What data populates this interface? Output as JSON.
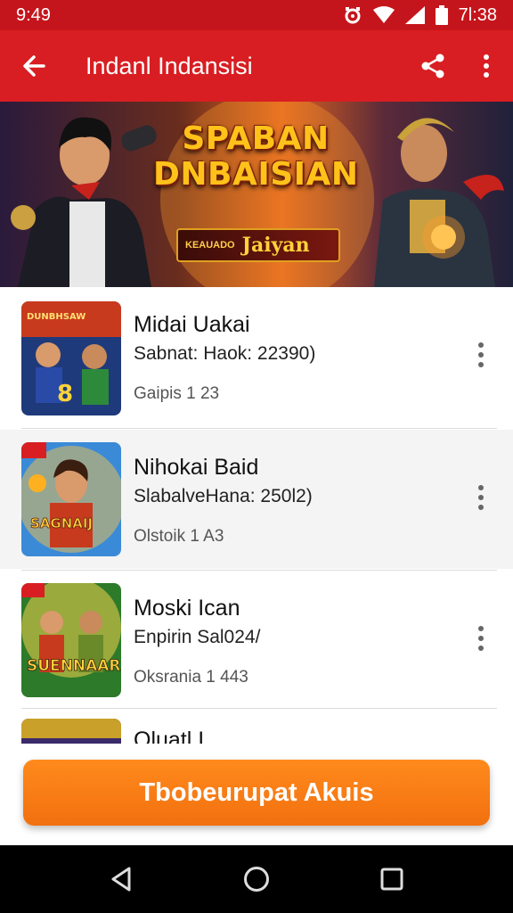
{
  "status_bar": {
    "time": "9:49",
    "clock": "7l:38",
    "icons": [
      "alarm-icon",
      "wifi-icon",
      "signal-icon",
      "battery-icon"
    ]
  },
  "app_bar": {
    "title": "Indanl Indansisi",
    "icons": [
      "back-arrow-icon",
      "share-icon",
      "more-vert-icon"
    ]
  },
  "banner": {
    "title_line1": "SPABAN",
    "title_line2": "DNBAISIAN",
    "tag_small": "KEAUADO",
    "tag_big": "Jaiyan"
  },
  "items": [
    {
      "title": "Midai Uakai",
      "subtitle": "Sabnat: Haok: 22390)",
      "meta": "Gaipis 1 23",
      "thumb_caption": "8"
    },
    {
      "title": "Nihokai Baid",
      "subtitle": "SlabalveHana: 250l2)",
      "meta": "Olstoik 1 A3",
      "thumb_caption": "SAGNAIJ"
    },
    {
      "title": "Moski Ican",
      "subtitle": "Enpirin Sal024/",
      "meta": "Oksrania 1 443",
      "thumb_caption": "SUENNAAR"
    },
    {
      "title": "Oluatl I"
    }
  ],
  "cta": {
    "label": "Tbobeurupat Akuis"
  },
  "colors": {
    "primary": "#d81e22",
    "status": "#c5151c",
    "cta": "#f2780f"
  }
}
